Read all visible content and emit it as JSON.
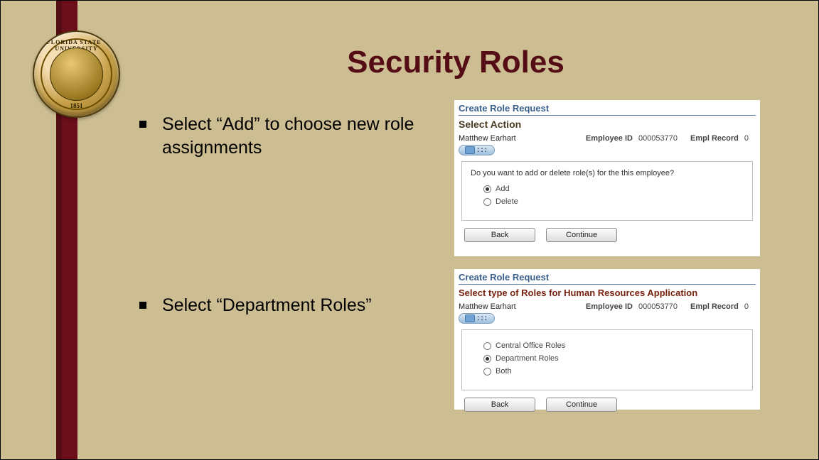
{
  "slide": {
    "title": "Security Roles",
    "bullets": [
      "Select “Add” to choose new role assignments",
      "Select “Department Roles”"
    ]
  },
  "seal": {
    "top_text": "FLORIDA STATE · UNIVERSITY",
    "bottom_text": "1851"
  },
  "card1": {
    "breadcrumb": "Create Role Request",
    "heading": "Select Action",
    "employee_name": "Matthew Earhart",
    "emp_id_label": "Employee ID",
    "emp_id": "000053770",
    "emp_rec_label": "Empl Record",
    "emp_rec": "0",
    "question": "Do you want to add or delete role(s) for the this employee?",
    "options": {
      "add": "Add",
      "delete": "Delete",
      "selected": "add"
    },
    "buttons": {
      "back": "Back",
      "continue": "Continue"
    }
  },
  "card2": {
    "breadcrumb": "Create Role Request",
    "heading": "Select type of Roles for Human Resources Application",
    "employee_name": "Matthew Earhart",
    "emp_id_label": "Employee ID",
    "emp_id": "000053770",
    "emp_rec_label": "Empl Record",
    "emp_rec": "0",
    "options": {
      "central": "Central Office Roles",
      "dept": "Department Roles",
      "both": "Both",
      "selected": "dept"
    },
    "buttons": {
      "back": "Back",
      "continue": "Continue"
    }
  }
}
